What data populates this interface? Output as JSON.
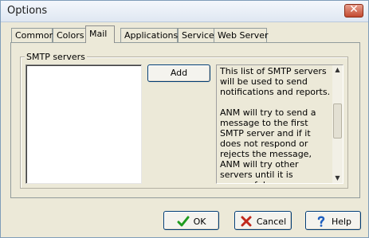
{
  "window": {
    "title": "Options",
    "close_glyph": "✕"
  },
  "tabs": [
    {
      "label": "Common"
    },
    {
      "label": "Colors"
    },
    {
      "label": "Mail"
    },
    {
      "label": "Applications"
    },
    {
      "label": "Service"
    },
    {
      "label": "Web Server"
    }
  ],
  "active_tab": "Mail",
  "mail": {
    "group_label": "SMTP servers",
    "add_label": "Add",
    "info_paragraph_1": "This list of SMTP servers will be used to send notifications and reports.",
    "info_paragraph_2": "ANM will try to send a message to the first SMTP server and if it does not respond or rejects the message, ANM will try other servers until it is successful."
  },
  "footer": {
    "ok_label": "OK",
    "cancel_label": "Cancel",
    "help_label": "Help"
  },
  "colors": {
    "ok_check": "#1e9b1e",
    "cancel_x": "#c0281c",
    "help_icon": "#1f5fbf"
  },
  "icons": {
    "ok": "check-icon",
    "cancel": "x-icon",
    "help": "help-question-icon"
  }
}
